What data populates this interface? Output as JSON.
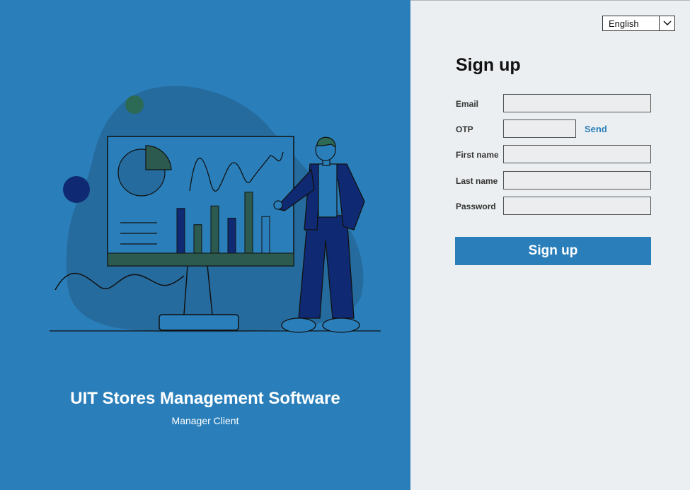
{
  "branding": {
    "title": "UIT Stores Management Software",
    "subtitle": "Manager Client"
  },
  "language": {
    "selected": "English"
  },
  "form": {
    "title": "Sign up",
    "fields": {
      "email": {
        "label": "Email",
        "value": ""
      },
      "otp": {
        "label": "OTP",
        "value": ""
      },
      "first_name": {
        "label": "First name",
        "value": ""
      },
      "last_name": {
        "label": "Last name",
        "value": ""
      },
      "password": {
        "label": "Password",
        "value": ""
      }
    },
    "send_label": "Send",
    "submit_label": "Sign up"
  },
  "illustration": {
    "name": "presenter-with-board-illustration",
    "bar_values": [
      0.55,
      0.35,
      0.58,
      0.43,
      0.75,
      0.45
    ]
  },
  "colors": {
    "primary": "#2A7FBA",
    "panel_background": "#ECEFF1",
    "input_background": "#ECEDEE",
    "dark_navy": "#0F2A72",
    "dark_green": "#2C5A4E"
  }
}
